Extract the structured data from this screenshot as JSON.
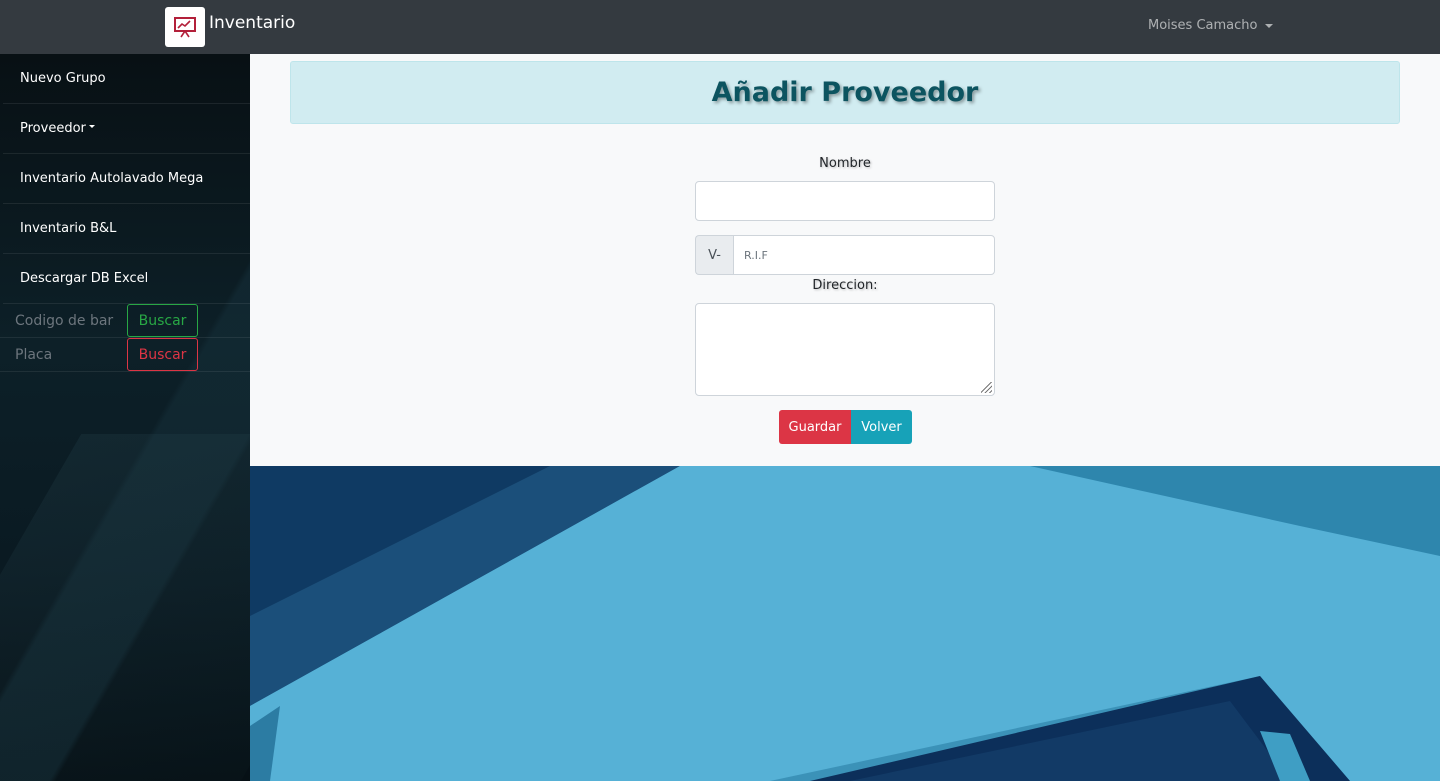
{
  "navbar": {
    "brand": "Inventario",
    "user_name": "Moises Camacho",
    "logo_icon": "presentation-chart-icon",
    "brand_color": "#b3203a"
  },
  "sidebar": {
    "items": [
      {
        "label": "Nuevo Grupo"
      },
      {
        "label": "Proveedor",
        "dropdown": true
      },
      {
        "label": "Inventario Autolavado Mega"
      },
      {
        "label": "Inventario B&L"
      },
      {
        "label": "Descargar DB Excel"
      }
    ],
    "search_barcode": {
      "placeholder": "Codigo de bar",
      "button": "Buscar",
      "color": "#28a745"
    },
    "search_plate": {
      "placeholder": "Placa",
      "button": "Buscar",
      "color": "#dc3545"
    }
  },
  "form": {
    "title": "Añadir Proveedor",
    "name_label": "Nombre",
    "rif_prefix": "V-",
    "rif_placeholder": "R.I.F",
    "address_label": "Direccion:",
    "save_button": "Guardar",
    "back_button": "Volver"
  },
  "colors": {
    "title_bg": "#d1ecf1",
    "title_text": "#0c5460",
    "save": "#dc3545",
    "back": "#17a2b8"
  }
}
